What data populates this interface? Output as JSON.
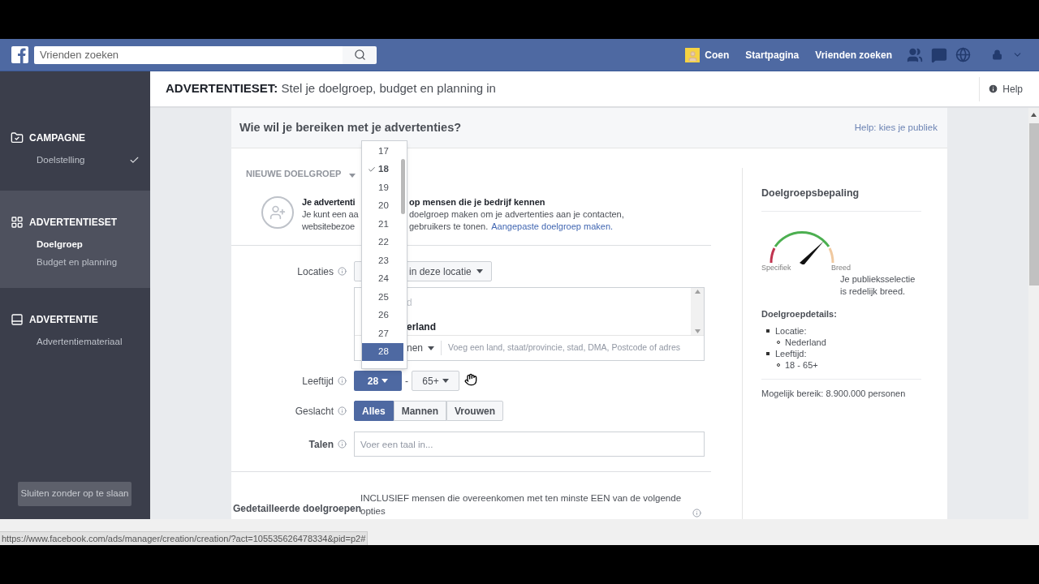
{
  "topbar": {
    "search": {
      "placeholder": "Vrienden zoeken"
    },
    "user": "Coen",
    "links": [
      "Startpagina",
      "Vrienden zoeken"
    ]
  },
  "sidebar": {
    "sections": [
      {
        "kind": "campaign",
        "title": "CAMPAGNE",
        "selected": false,
        "items": [
          {
            "label": "Doelstelling",
            "selected": false,
            "checked": true
          }
        ]
      },
      {
        "kind": "adset",
        "title": "ADVERTENTIESET",
        "selected": true,
        "items": [
          {
            "label": "Doelgroep",
            "selected": true,
            "checked": false
          },
          {
            "label": "Budget en planning",
            "selected": false,
            "checked": false
          }
        ]
      },
      {
        "kind": "ad",
        "title": "ADVERTENTIE",
        "selected": false,
        "items": [
          {
            "label": "Advertentiemateriaal",
            "selected": false,
            "checked": false
          }
        ]
      }
    ],
    "close_button": "Sluiten zonder op te slaan"
  },
  "header": {
    "title": "**ADVERTENTIESET:** Stel je doelgroep, budget en planning in",
    "help": "Help"
  },
  "panel": {
    "title": "Wie wil je bereiken met je advertenties?",
    "help_link": "Help: kies je publiek",
    "audience_menu": "NIEUWE DOELGROEP",
    "intro": {
      "heading": [
        "Je advertenti",
        "op mensen die je bedrijf kennen"
      ],
      "line_2": [
        "Je kunt een aa",
        "doelgroep maken om je advertenties aan je contacten,"
      ],
      "line_3": [
        "websitebezoe",
        "gebruikers te tonen."
      ],
      "link": "Aangepaste doelgroep maken."
    },
    "locations": {
      "label": "Locaties",
      "mode": "in deze locatie",
      "list": [
        "d",
        "erland"
      ],
      "type": "nen",
      "placeholder": "Voeg een land, staat/provincie, stad, DMA, Postcode of adres"
    },
    "age": {
      "label": "Leeftijd",
      "from": "28",
      "separator": "-",
      "to": "65+"
    },
    "gender": {
      "label": "Geslacht",
      "options": [
        {
          "label": "Alles",
          "selected": true
        },
        {
          "label": "Mannen",
          "selected": false
        },
        {
          "label": "Vrouwen",
          "selected": false
        }
      ]
    },
    "languages": {
      "label": "Talen",
      "placeholder": "Voer een taal in..."
    },
    "detailed": {
      "label": "Gedetailleerde doelgroepen",
      "text": "INCLUSIEF mensen die overeenkomen met ten minste EEN van de volgende opties"
    },
    "age_menu": [
      {
        "label": "17",
        "selected": false,
        "checked": false
      },
      {
        "label": "18",
        "selected": false,
        "checked": true
      },
      {
        "label": "19",
        "selected": false,
        "checked": false
      },
      {
        "label": "20",
        "selected": false,
        "checked": false
      },
      {
        "label": "21",
        "selected": false,
        "checked": false
      },
      {
        "label": "22",
        "selected": false,
        "checked": false
      },
      {
        "label": "23",
        "selected": false,
        "checked": false
      },
      {
        "label": "24",
        "selected": false,
        "checked": false
      },
      {
        "label": "25",
        "selected": false,
        "checked": false
      },
      {
        "label": "26",
        "selected": false,
        "checked": false
      },
      {
        "label": "27",
        "selected": false,
        "checked": false
      },
      {
        "label": "28",
        "selected": true,
        "checked": false
      }
    ],
    "summary": {
      "title": "Doelgroepsbepaling",
      "gauge": {
        "low": "Specifiek",
        "high": "Breed"
      },
      "verdict": "Je publieksselectie is redelijk breed.",
      "details_title": "Doelgroepdetails:",
      "details": [
        {
          "label": "Locatie:",
          "values": [
            "Nederland"
          ]
        },
        {
          "label": "Leeftijd:",
          "values": [
            "18 - 65+"
          ]
        }
      ],
      "reach": "Mogelijk bereik: 8.900.000 personen"
    }
  },
  "status_url": "https://www.facebook.com/ads/manager/creation/creation/?act=105535626478334&pid=p2#"
}
